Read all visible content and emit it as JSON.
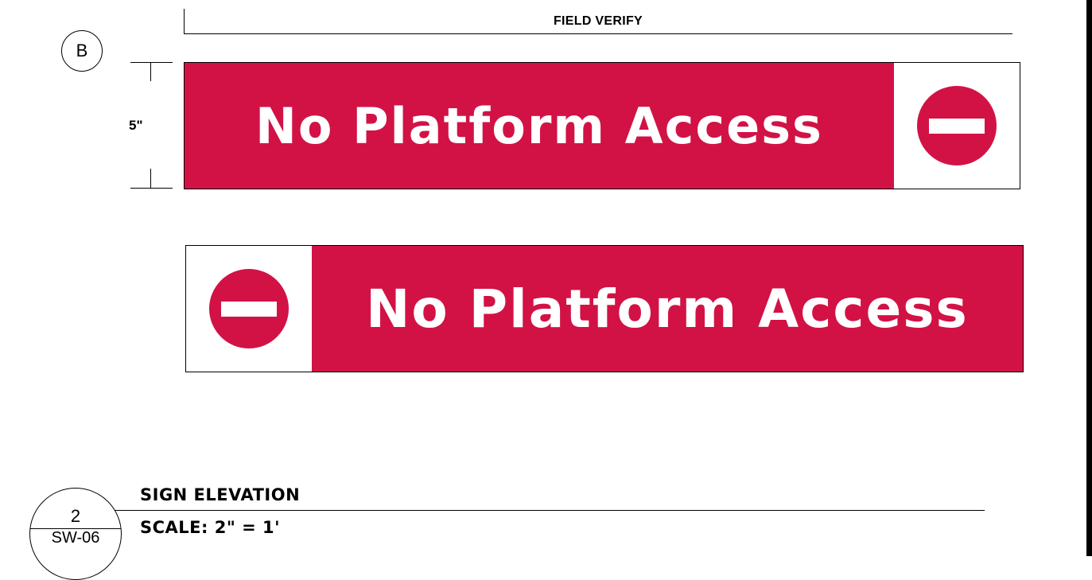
{
  "detail_marker": "B",
  "field_verify_label": "FIELD VERIFY",
  "dimension_label": "5\"",
  "colors": {
    "sign_red": "#d21245",
    "sign_text": "#ffffff",
    "line": "#000000"
  },
  "signs": [
    {
      "text": "No Platform Access",
      "icon": "no-entry-icon",
      "icon_side": "right"
    },
    {
      "text": "No Platform Access",
      "icon": "no-entry-icon",
      "icon_side": "left"
    }
  ],
  "title_block": {
    "drawing_number": "2",
    "sheet": "SW-06",
    "title": "SIGN ELEVATION",
    "scale": "SCALE: 2\" = 1'"
  }
}
